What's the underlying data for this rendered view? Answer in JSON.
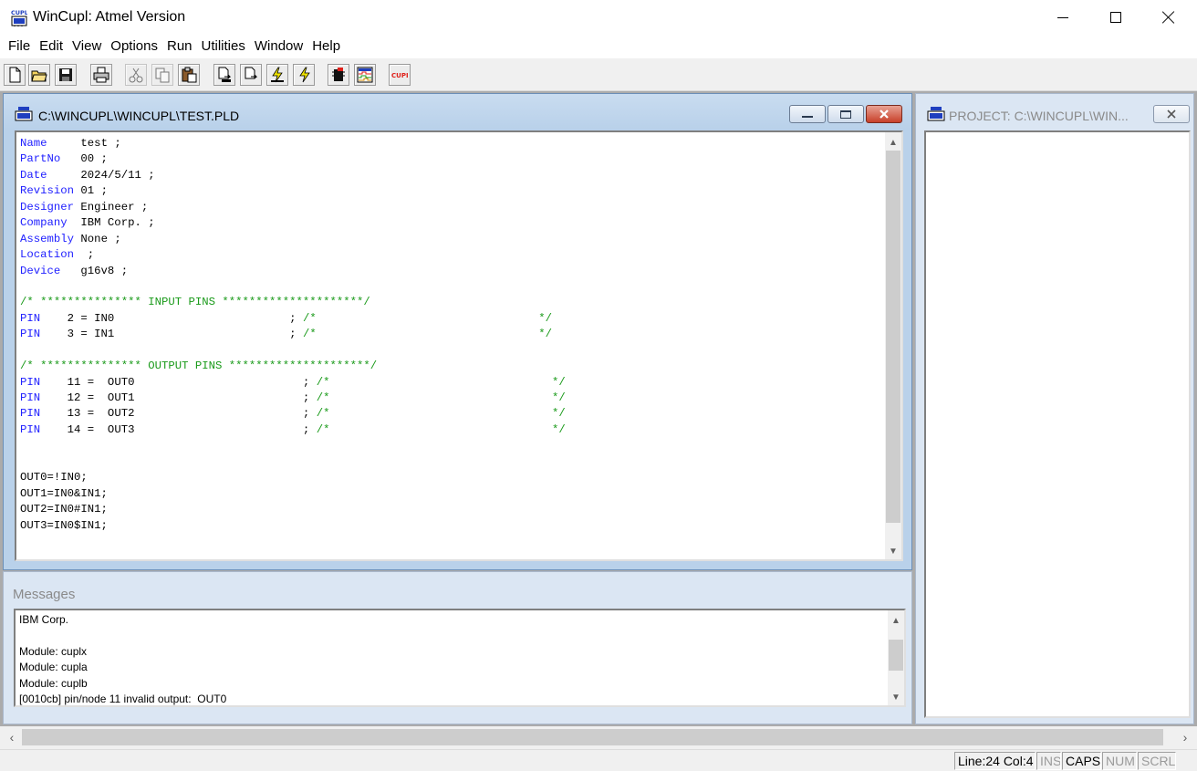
{
  "app": {
    "title": "WinCupl:  Atmel Version",
    "icon": "cupl-app-icon",
    "controls": {
      "minimize": "minimize-icon",
      "maximize": "maximize-icon",
      "close": "close-icon"
    }
  },
  "menu": {
    "items": [
      "File",
      "Edit",
      "View",
      "Options",
      "Run",
      "Utilities",
      "Window",
      "Help"
    ]
  },
  "toolbar": {
    "buttons": [
      "new-file-icon",
      "open-folder-icon",
      "save-icon",
      "print-icon",
      "cut-icon",
      "copy-icon",
      "paste-icon",
      "compile-icon",
      "device-dependent-compile-icon",
      "simulate-icon",
      "device-dependent-simulate-icon",
      "device-selection-icon",
      "waveform-icon",
      "cupl-icon"
    ],
    "cupl_label": "CUPL",
    "app_icon_label": "CUPL"
  },
  "editor": {
    "title": "C:\\WINCUPL\\WINCUPL\\TEST.PLD",
    "lines": [
      [
        {
          "t": "Name",
          "c": "kw"
        },
        {
          "t": "     test ;"
        }
      ],
      [
        {
          "t": "PartNo",
          "c": "kw"
        },
        {
          "t": "   00 ;"
        }
      ],
      [
        {
          "t": "Date",
          "c": "kw"
        },
        {
          "t": "     2024/5/11 ;"
        }
      ],
      [
        {
          "t": "Revision",
          "c": "kw"
        },
        {
          "t": " 01 ;"
        }
      ],
      [
        {
          "t": "Designer",
          "c": "kw"
        },
        {
          "t": " Engineer ;"
        }
      ],
      [
        {
          "t": "Company",
          "c": "kw"
        },
        {
          "t": "  IBM Corp. ;"
        }
      ],
      [
        {
          "t": "Assembly",
          "c": "kw"
        },
        {
          "t": " None ;"
        }
      ],
      [
        {
          "t": "Location",
          "c": "kw"
        },
        {
          "t": "  ;"
        }
      ],
      [
        {
          "t": "Device",
          "c": "kw"
        },
        {
          "t": "   g16v8 ;"
        }
      ],
      [],
      [
        {
          "t": "/* *************** INPUT PINS *********************/",
          "c": "cm"
        }
      ],
      [
        {
          "t": "PIN",
          "c": "kw"
        },
        {
          "t": "    2 = IN0                          ; "
        },
        {
          "t": "/*                                 */",
          "c": "cm"
        }
      ],
      [
        {
          "t": "PIN",
          "c": "kw"
        },
        {
          "t": "    3 = IN1                          ; "
        },
        {
          "t": "/*                                 */",
          "c": "cm"
        }
      ],
      [],
      [
        {
          "t": "/* *************** OUTPUT PINS *********************/",
          "c": "cm"
        }
      ],
      [
        {
          "t": "PIN",
          "c": "kw"
        },
        {
          "t": "    11 =  OUT0                         ; "
        },
        {
          "t": "/*                                 */",
          "c": "cm"
        }
      ],
      [
        {
          "t": "PIN",
          "c": "kw"
        },
        {
          "t": "    12 =  OUT1                         ; "
        },
        {
          "t": "/*                                 */",
          "c": "cm"
        }
      ],
      [
        {
          "t": "PIN",
          "c": "kw"
        },
        {
          "t": "    13 =  OUT2                         ; "
        },
        {
          "t": "/*                                 */",
          "c": "cm"
        }
      ],
      [
        {
          "t": "PIN",
          "c": "kw"
        },
        {
          "t": "    14 =  OUT3                         ; "
        },
        {
          "t": "/*                                 */",
          "c": "cm"
        }
      ],
      [],
      [],
      [
        {
          "t": "OUT0=!IN0;"
        }
      ],
      [
        {
          "t": "OUT1=IN0&IN1;"
        }
      ],
      [
        {
          "t": "OUT2=IN0#IN1;"
        }
      ],
      [
        {
          "t": "OUT3=IN0$IN1;"
        }
      ]
    ]
  },
  "project": {
    "title": "PROJECT: C:\\WINCUPL\\WIN..."
  },
  "messages": {
    "title": "Messages",
    "lines": [
      "IBM Corp.",
      "",
      "Module: cuplx",
      "Module: cupla",
      "Module: cuplb",
      "[0010cb] pin/node 11 invalid output:  OUT0"
    ]
  },
  "status": {
    "position": "Line:24 Col:4",
    "ins": "INS",
    "caps": "CAPS",
    "num": "NUM",
    "scrl": "SCRL"
  },
  "colors": {
    "keyword": "#2020ff",
    "comment": "#1a9a1a",
    "active_frame": "#b9d1ea",
    "inactive_frame": "#dbe6f3"
  }
}
